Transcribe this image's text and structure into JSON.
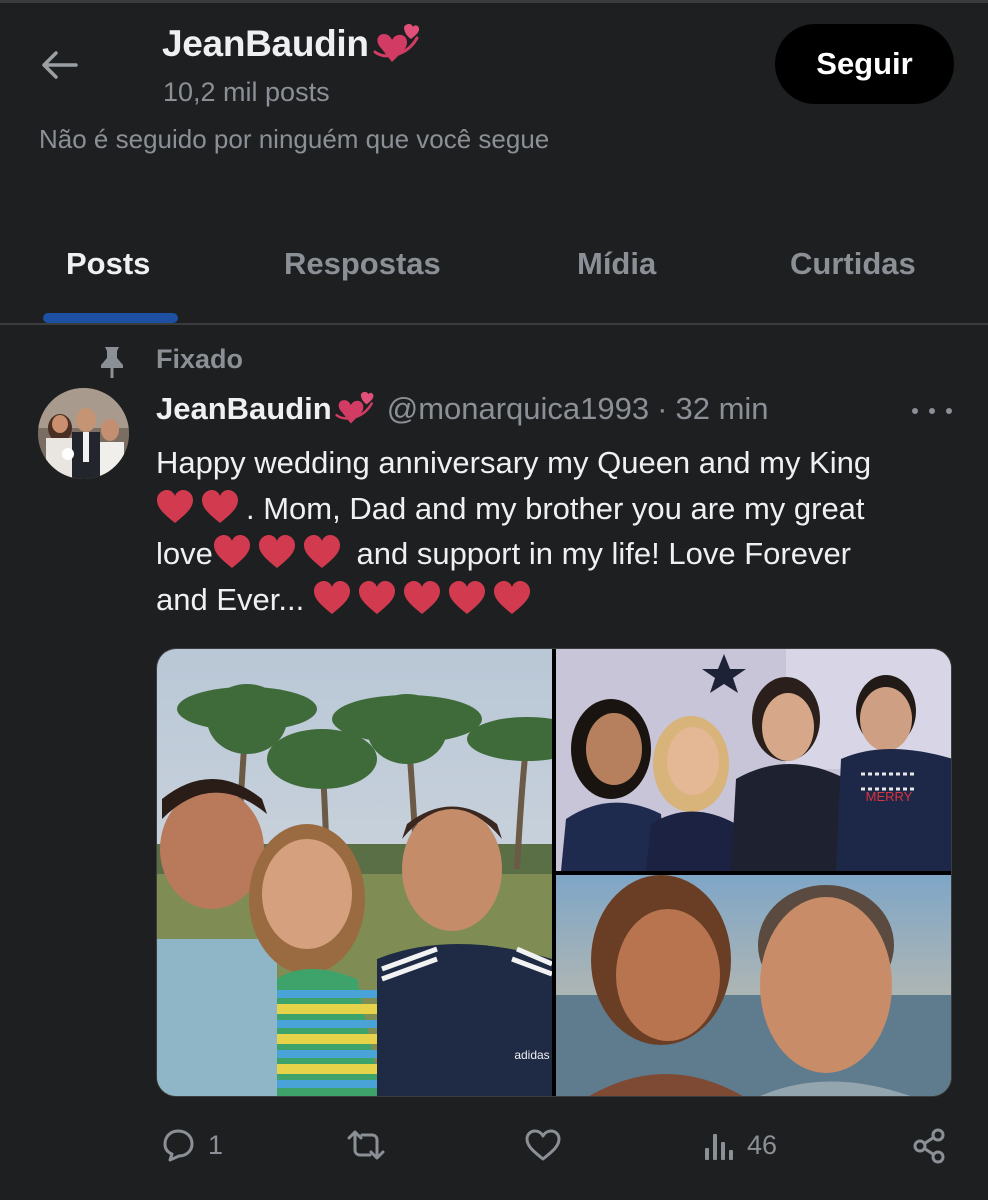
{
  "header": {
    "back_icon": "arrow-left-icon",
    "profile_name": "JeanBaudin",
    "profile_emoji": "revolving-hearts-icon",
    "post_count": "10,2 mil posts",
    "follow_label": "Seguir",
    "followers_note": "Não é seguido por ninguém que você segue"
  },
  "tabs": [
    {
      "label": "Posts",
      "active": true
    },
    {
      "label": "Respostas",
      "active": false
    },
    {
      "label": "Mídia",
      "active": false
    },
    {
      "label": "Curtidas",
      "active": false
    }
  ],
  "pinned": {
    "label": "Fixado",
    "icon": "pin-icon"
  },
  "tweet": {
    "author_name": "JeanBaudin",
    "author_handle": "@monarquica1993",
    "separator": "·",
    "time": "32 min",
    "text_lines": [
      "Happy wedding anniversary my Queen and my King",
      ". Mom, Dad and my brother you are my great",
      "love",
      " and support in my life! Love Forever",
      "and Ever..."
    ],
    "media": [
      {
        "name": "photo-family-beach-palms"
      },
      {
        "name": "photo-christmas-sweaters"
      },
      {
        "name": "photo-couple-selfie-sunset"
      }
    ],
    "actions": {
      "replies": "1",
      "reposts": "",
      "likes": "",
      "views": "46"
    }
  },
  "colors": {
    "background": "#1e1f20",
    "text_primary": "#eef0f1",
    "text_secondary": "#8b9096",
    "tab_indicator": "#1d4fa3",
    "heart_red": "#d23b4f"
  }
}
